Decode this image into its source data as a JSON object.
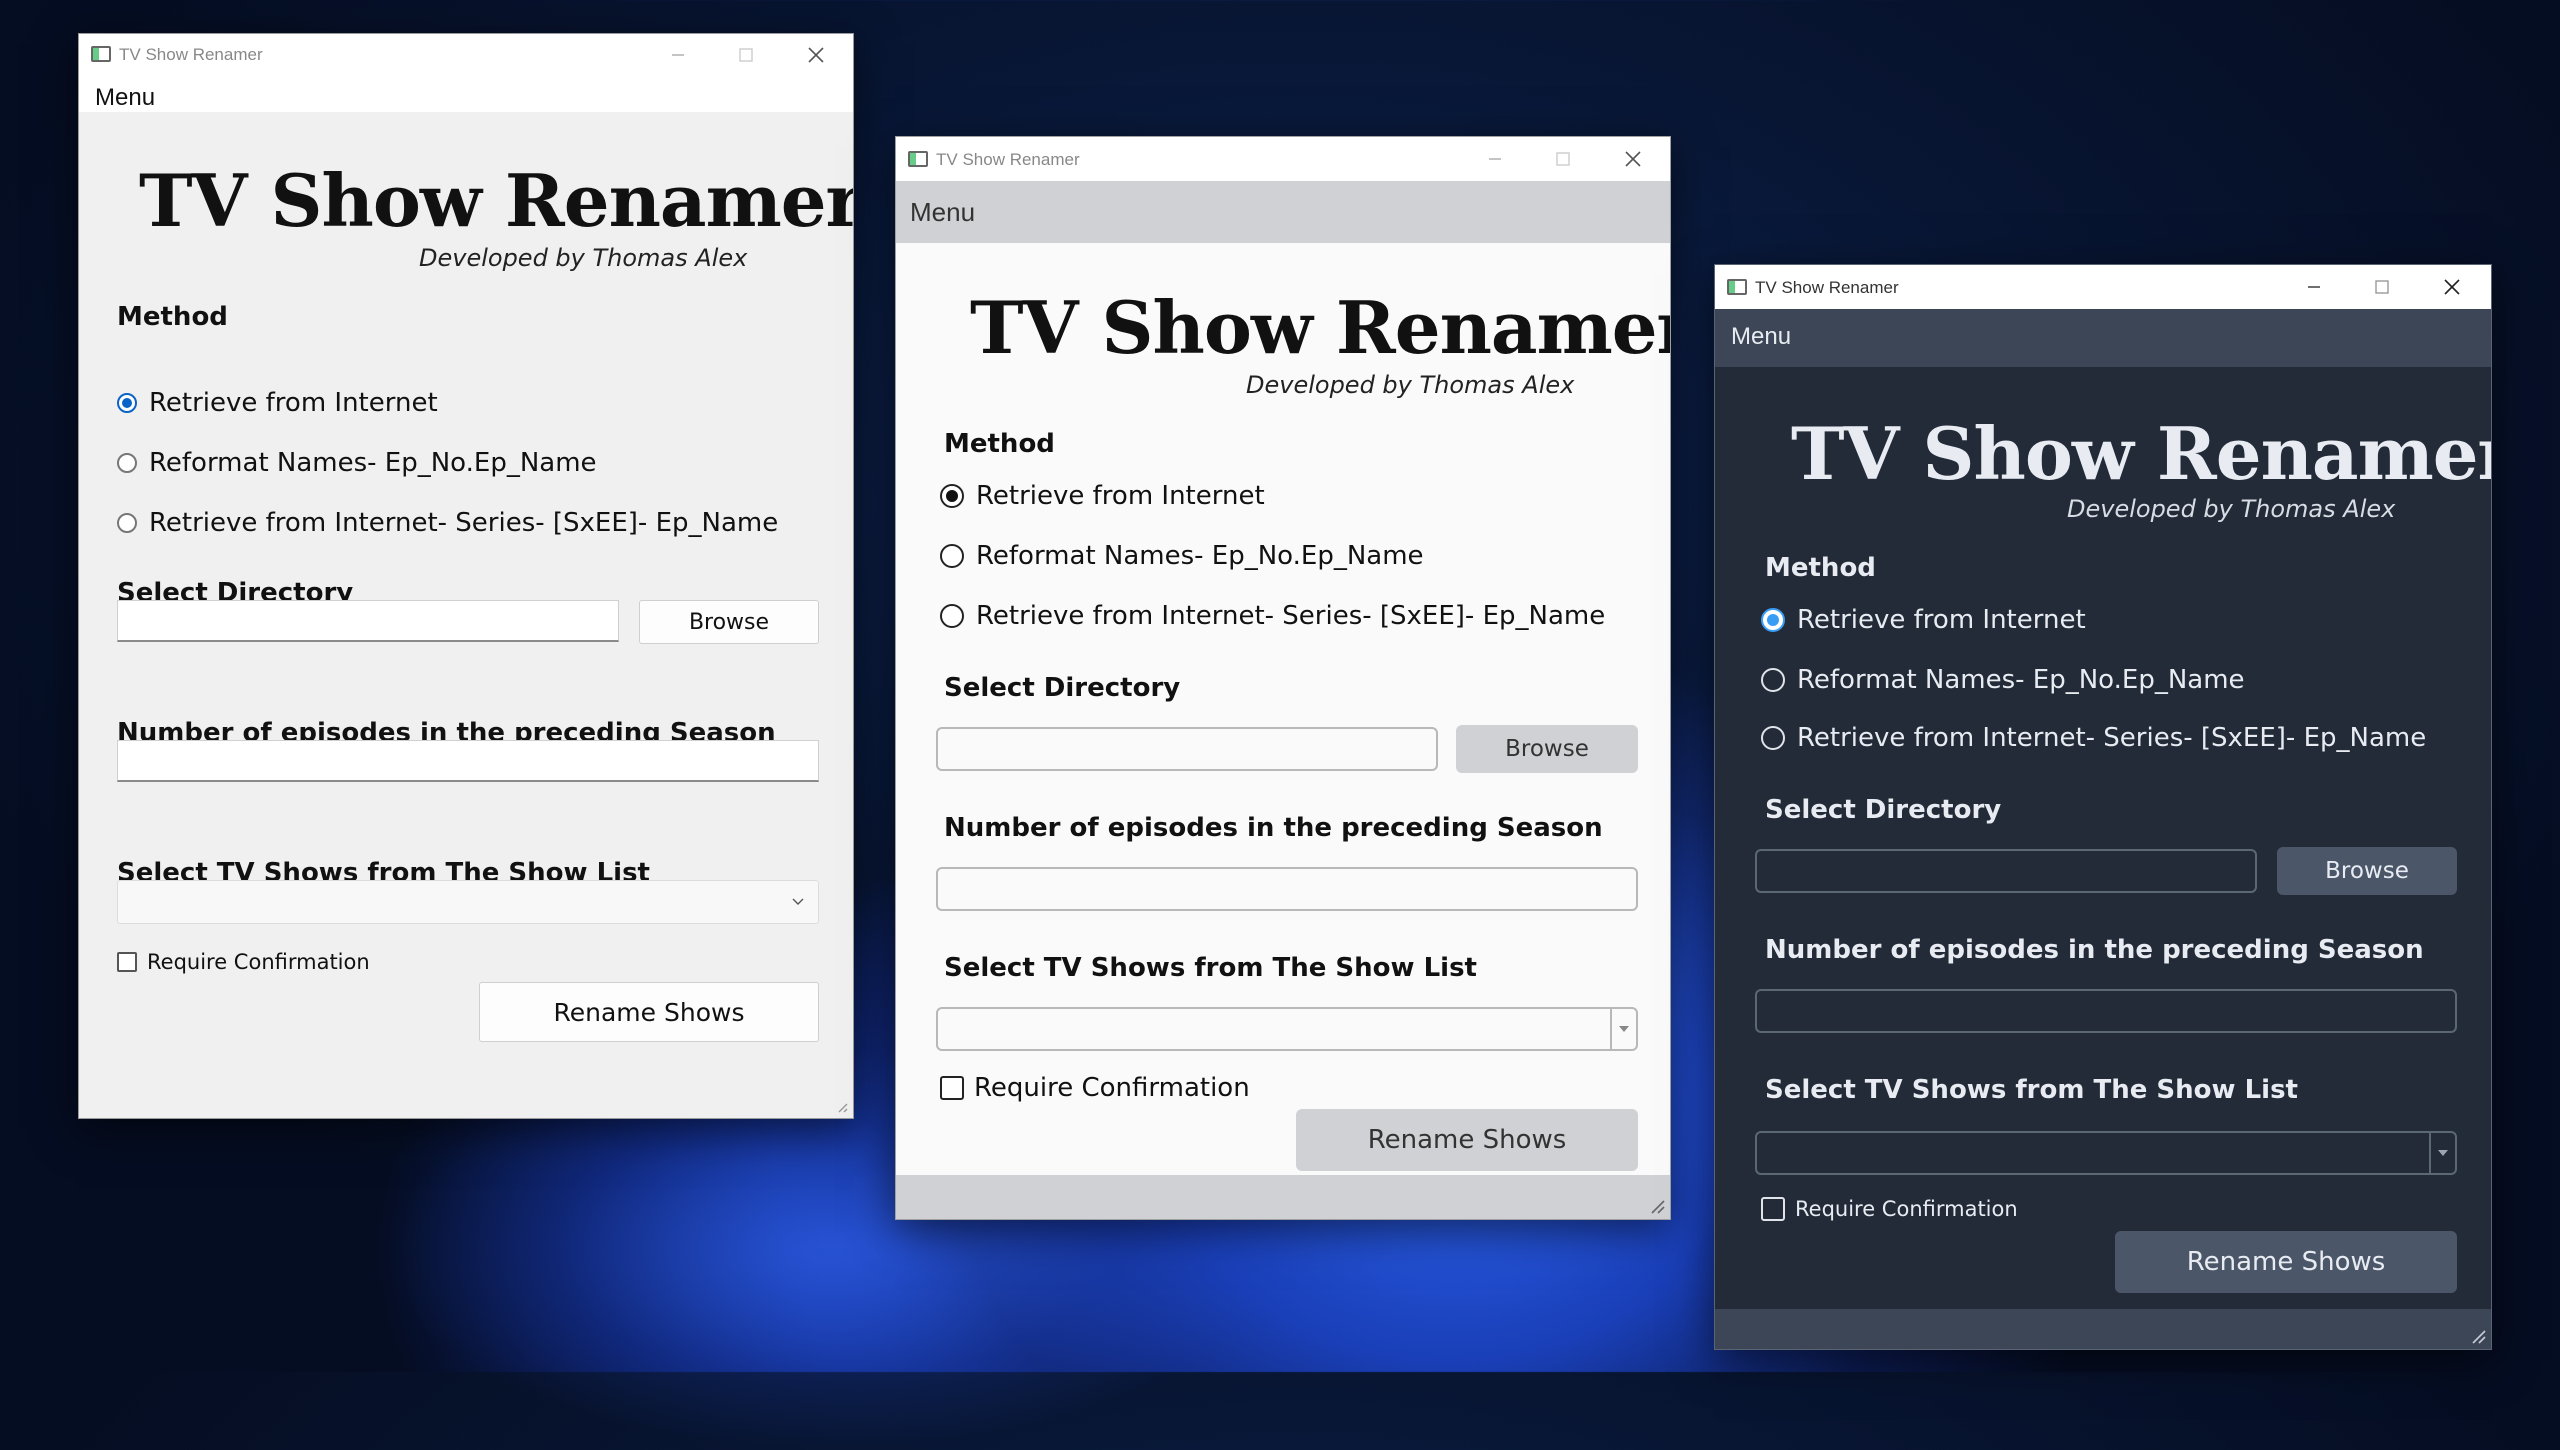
{
  "colors": {
    "desktop_bg": "#081634",
    "accent_blue": "#0a64c8",
    "dark_theme_bg": "#222b37",
    "dark_theme_radio": "#3a9df5",
    "gray_theme_menubar": "#cfd1d4"
  },
  "windows": [
    {
      "theme": "native-light",
      "title": "TV Show Renamer",
      "menu_label": "Menu",
      "app_title": "TV Show Renamer",
      "subtitle": "Developed by Thomas Alex",
      "method_heading": "Method",
      "methods": [
        {
          "label": "Retrieve from Internet",
          "checked": true
        },
        {
          "label": "Reformat Names- Ep_No.Ep_Name",
          "checked": false
        },
        {
          "label": "Retrieve from Internet- Series- [SxEE]- Ep_Name",
          "checked": false
        }
      ],
      "directory_heading": "Select Directory",
      "directory_value": "",
      "browse_label": "Browse",
      "episodes_heading": "Number of episodes in the preceding Season",
      "episodes_value": "",
      "shows_heading": "Select TV Shows from The Show List",
      "shows_selected": "",
      "confirm_label": "Require Confirmation",
      "confirm_checked": false,
      "rename_label": "Rename Shows"
    },
    {
      "theme": "gray",
      "title": "TV Show Renamer",
      "menu_label": "Menu",
      "app_title": "TV Show Renamer",
      "subtitle": "Developed by Thomas Alex",
      "method_heading": "Method",
      "methods": [
        {
          "label": "Retrieve from Internet",
          "checked": true
        },
        {
          "label": "Reformat Names- Ep_No.Ep_Name",
          "checked": false
        },
        {
          "label": "Retrieve from Internet- Series- [SxEE]- Ep_Name",
          "checked": false
        }
      ],
      "directory_heading": "Select Directory",
      "directory_value": "",
      "browse_label": "Browse",
      "episodes_heading": "Number of episodes in the preceding Season",
      "episodes_value": "",
      "shows_heading": "Select TV Shows from The Show List",
      "shows_selected": "",
      "confirm_label": "Require Confirmation",
      "confirm_checked": false,
      "rename_label": "Rename Shows"
    },
    {
      "theme": "dark",
      "title": "TV Show Renamer",
      "menu_label": "Menu",
      "app_title": "TV Show Renamer",
      "subtitle": "Developed by Thomas Alex",
      "method_heading": "Method",
      "methods": [
        {
          "label": "Retrieve from Internet",
          "checked": true
        },
        {
          "label": "Reformat Names- Ep_No.Ep_Name",
          "checked": false
        },
        {
          "label": "Retrieve from Internet- Series- [SxEE]- Ep_Name",
          "checked": false
        }
      ],
      "directory_heading": "Select Directory",
      "directory_value": "",
      "browse_label": "Browse",
      "episodes_heading": "Number of episodes in the preceding Season",
      "episodes_value": "",
      "shows_heading": "Select TV Shows from The Show List",
      "shows_selected": "",
      "confirm_label": "Require Confirmation",
      "confirm_checked": false,
      "rename_label": "Rename Shows"
    }
  ],
  "icons": {
    "minimize": "minimize-icon",
    "maximize": "maximize-icon",
    "close": "close-icon",
    "dropdown": "chevron-down-icon",
    "app": "app-icon",
    "resize": "resize-grip-icon"
  }
}
